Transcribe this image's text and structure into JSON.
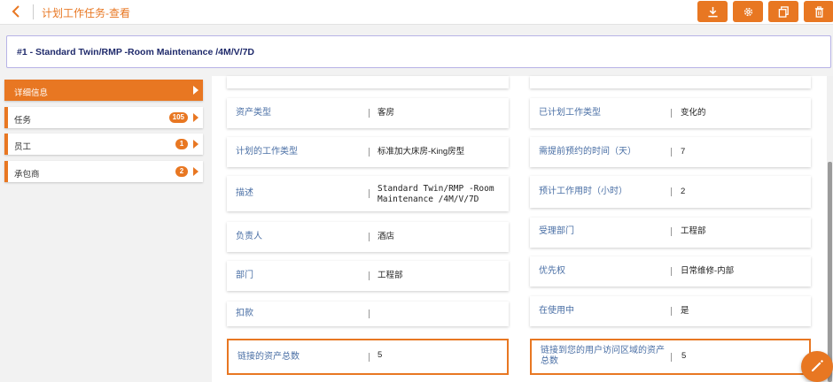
{
  "header": {
    "title": "计划工作任务-查看",
    "toolbar": {
      "download_icon": "download-icon",
      "settings_icon": "gear-icon",
      "copy_icon": "copy-icon",
      "delete_icon": "trash-icon"
    }
  },
  "record": {
    "title": "#1 - Standard Twin/RMP -Room Maintenance /4M/V/7D"
  },
  "sidebar": {
    "items": [
      {
        "label": "详细信息",
        "count": null,
        "active": true
      },
      {
        "label": "任务",
        "count": "105",
        "active": false
      },
      {
        "label": "员工",
        "count": "1",
        "active": false
      },
      {
        "label": "承包商",
        "count": "2",
        "active": false
      }
    ]
  },
  "fields": {
    "asset_type": {
      "label": "资产类型",
      "value": "客房"
    },
    "planned_work_type": {
      "label": "已计划工作类型",
      "value": "变化的"
    },
    "planned_task_type": {
      "label": "计划的工作类型",
      "value": "标准加大床房-King房型"
    },
    "advance_days": {
      "label": "需提前预约的时间（天）",
      "value": "7"
    },
    "description": {
      "label": "描述",
      "value": "Standard Twin/RMP -Room Maintenance /4M/V/7D"
    },
    "est_hours": {
      "label": "预计工作用时（小时）",
      "value": "2"
    },
    "owner": {
      "label": "负责人",
      "value": "酒店"
    },
    "handling_dept": {
      "label": "受理部门",
      "value": "工程部"
    },
    "department": {
      "label": "部门",
      "value": "工程部"
    },
    "priority": {
      "label": "优先权",
      "value": "日常维修-内部"
    },
    "deduction": {
      "label": "扣款",
      "value": ""
    },
    "in_use": {
      "label": "在使用中",
      "value": "是"
    },
    "linked_assets_total": {
      "label": "链接的资产总数",
      "value": "5"
    },
    "linked_assets_user_area": {
      "label": "链接到您的用户访问区域的资产总数",
      "value": "5"
    }
  },
  "colors": {
    "accent": "#e87722",
    "label": "#4a6fa5",
    "title": "#1f2a6b"
  },
  "fab": {
    "icon": "edit-pencil-icon"
  }
}
